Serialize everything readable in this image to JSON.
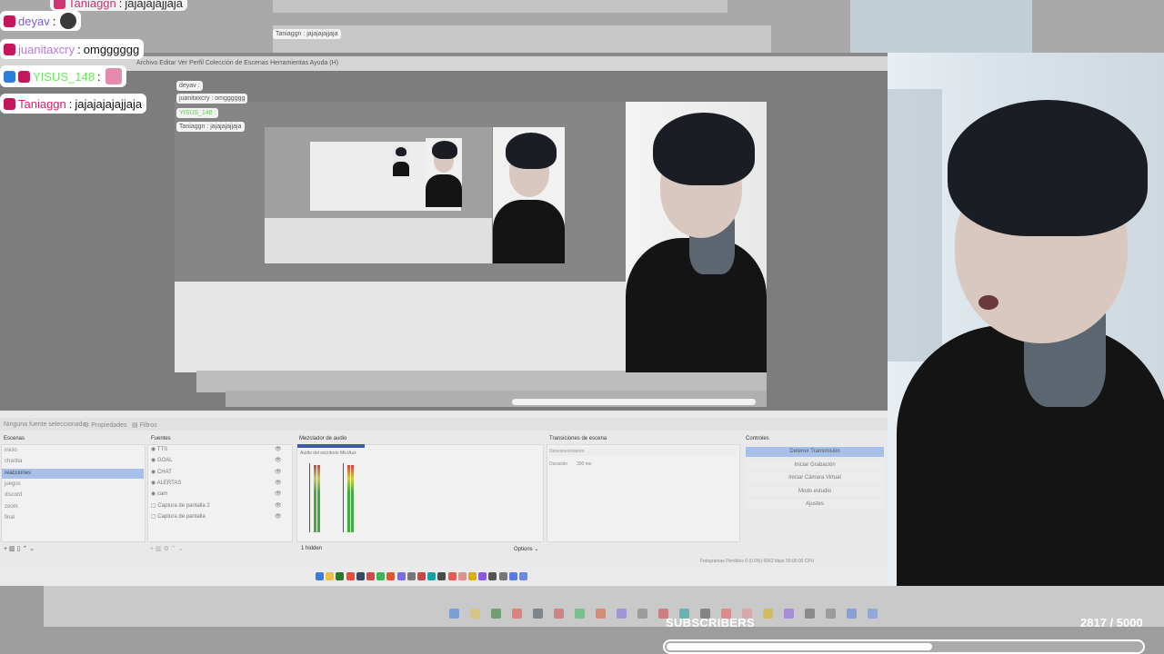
{
  "chat": {
    "messages": [
      {
        "user": "deyav",
        "separator": ":",
        "message": "",
        "user_color": "#7b5bd6",
        "emote": true
      },
      {
        "user": "juanitaxcry",
        "separator": ":",
        "message": "omgggggg",
        "user_color": "#b47ad8",
        "emote": false
      },
      {
        "user": "YISUS_148",
        "separator": ":",
        "message": "",
        "user_color": "#67e85d",
        "emote": true
      },
      {
        "user": "Taniaggn",
        "separator": ":",
        "message": "jajajajajajjaja",
        "user_color": "#d6206a",
        "emote": false
      }
    ],
    "top_cut_message": {
      "user": "Taniaggn",
      "message": "jajajajajjaja"
    }
  },
  "subscriber_goal": {
    "label": "SUBSCRIBERS",
    "current": 2817,
    "goal": 5000,
    "display": "2817 / 5000",
    "fill_fraction": 0.5634
  },
  "obs": {
    "menu": "Archivo  Editar  Ver  Perfil  Colección de Escenas  Herramientas  Ayuda (H)",
    "no_source_text": "Ninguna fuente seleccionada",
    "properties_label": "Propiedades",
    "filters_label": "Filtros",
    "scenes_title": "Escenas",
    "scenes": [
      "inicio",
      "charlita",
      "reacciones",
      "juegos",
      "discord",
      "zoom",
      "final"
    ],
    "selected_scene_index": 2,
    "sources_title": "Fuentes",
    "sources": [
      "TTS",
      "GOAL",
      "CHAT",
      "ALERTAS",
      "cam",
      "Captura de pantalla 2",
      "Captura de pantalla"
    ],
    "audio_title": "Mezclador de audio",
    "audio_channels": [
      "Audio del escritorio",
      "Mic/Aux"
    ],
    "audio_hidden": "1 hidden",
    "audio_options": "Options",
    "transitions_title": "Transiciones de escena",
    "transition_type": "Desvanecimiento",
    "duration_label": "Duración",
    "duration_value": "300 ms",
    "controls_title": "Controles",
    "controls": [
      "Detener Transmisión",
      "Iniciar Grabación",
      "Iniciar Cámara Virtual",
      "Modo estudio",
      "Ajustes"
    ],
    "status": "Fotogramas Perdidos 0 (0.0%)   6062 kbps   00:00:00   CPU"
  },
  "colors": {
    "chat_bg": "#ffffff",
    "obs_selection": "#a7c0e8",
    "bar_fill": "#ffffff"
  }
}
